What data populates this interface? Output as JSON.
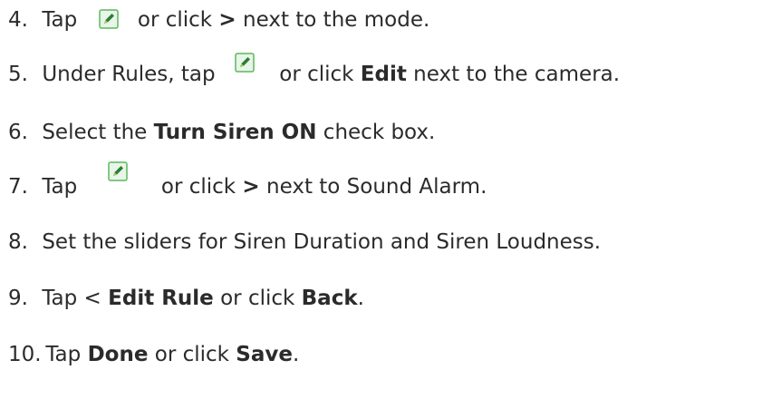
{
  "steps": [
    {
      "number": "4.",
      "t1": "Tap",
      "icon": "edit-pencil-icon",
      "t2": "or click",
      "b1": ">",
      "t3": "next to the mode."
    },
    {
      "number": "5.",
      "t1": "Under Rules, tap",
      "icon": "edit-pencil-icon",
      "t2": "or click",
      "b1": "Edit",
      "t3": "next to the camera."
    },
    {
      "number": "6.",
      "t1": "Select the",
      "b1": "Turn Siren ON",
      "t2": "check box."
    },
    {
      "number": "7.",
      "t1": "Tap",
      "icon": "edit-pencil-icon",
      "t2": "or click",
      "b1": ">",
      "t3": "next to Sound Alarm."
    },
    {
      "number": "8.",
      "t1": "Set the sliders for Siren Duration and Siren Loudness."
    },
    {
      "number": "9.",
      "t1": "Tap <",
      "b1": "Edit Rule",
      "t2": "or click",
      "b2": "Back",
      "t3": "."
    },
    {
      "number": "10.",
      "t1": "Tap",
      "b1": "Done",
      "t2": "or click",
      "b2": "Save",
      "t3": "."
    }
  ],
  "colors": {
    "text": "#2b2b2b",
    "icon_green": "#5cb85c",
    "icon_pencil": "#2e7d32"
  }
}
